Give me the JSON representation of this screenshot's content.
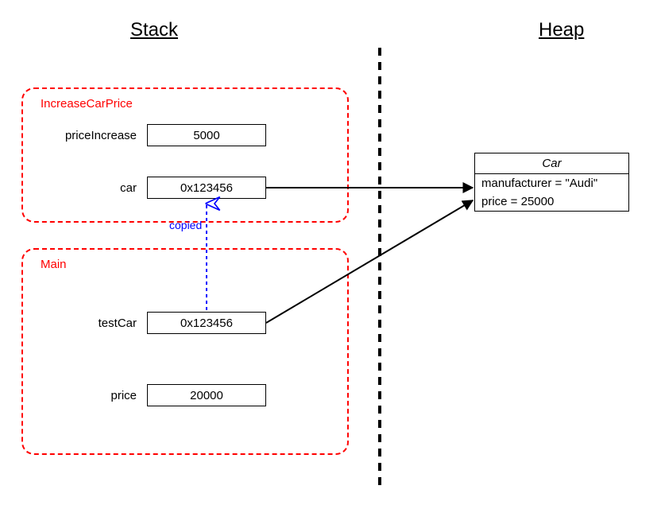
{
  "headings": {
    "stack": "Stack",
    "heap": "Heap"
  },
  "frames": {
    "increase": {
      "title": "IncreaseCarPrice",
      "vars": {
        "priceIncrease": {
          "label": "priceIncrease",
          "value": "5000"
        },
        "car": {
          "label": "car",
          "value": "0x123456"
        }
      }
    },
    "main": {
      "title": "Main",
      "vars": {
        "testCar": {
          "label": "testCar",
          "value": "0x123456"
        },
        "price": {
          "label": "price",
          "value": "20000"
        }
      }
    }
  },
  "heap": {
    "car": {
      "title": "Car",
      "manufacturer": "manufacturer = \"Audi\"",
      "price": "price = 25000"
    }
  },
  "annotations": {
    "copied": "copied"
  },
  "colors": {
    "frame": "#ff0000",
    "copied": "#0000ff"
  }
}
